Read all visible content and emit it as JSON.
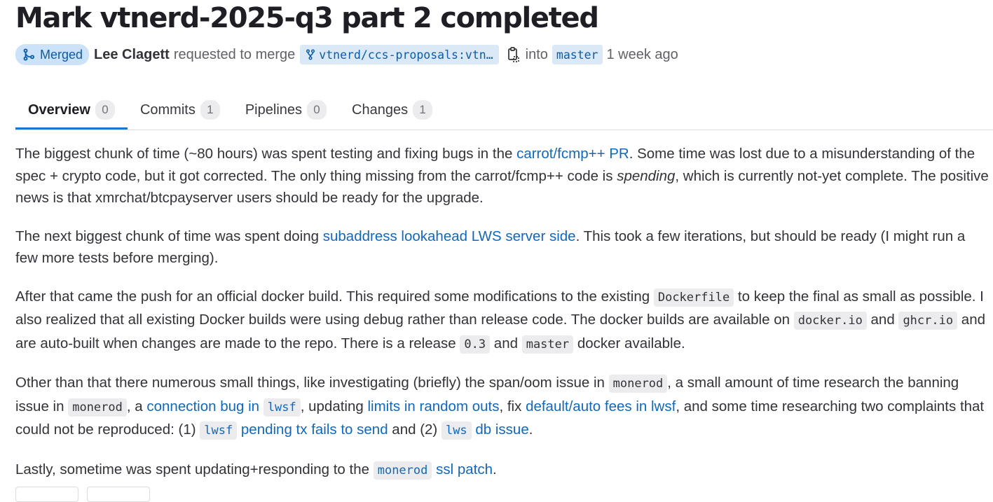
{
  "title": "Mark vtnerd-2025-q3 part 2 completed",
  "meta": {
    "status": "Merged",
    "author": "Lee Clagett",
    "action": "requested to merge",
    "source_branch": "vtnerd/ccs-proposals:vtn…",
    "into": "into",
    "target_branch": "master",
    "time": "1 week ago"
  },
  "tabs": [
    {
      "label": "Overview",
      "count": "0"
    },
    {
      "label": "Commits",
      "count": "1"
    },
    {
      "label": "Pipelines",
      "count": "0"
    },
    {
      "label": "Changes",
      "count": "1"
    }
  ],
  "p1": {
    "t1": "The biggest chunk of time (~80 hours) was spent testing and fixing bugs in the ",
    "link": "carrot/fcmp++ PR",
    "t2": ". Some time was lost due to a misunderstanding of the spec + crypto code, but it got corrected. The only thing missing from the carrot/fcmp++ code is ",
    "em": "spending",
    "t3": ", which is currently not-yet complete. The positive news is that xmrchat/btcpayserver users should be ready for the upgrade."
  },
  "p2": {
    "t1": "The next biggest chunk of time was spent doing ",
    "link": "subaddress lookahead LWS server side",
    "t2": ". This took a few iterations, but should be ready (I might run a few more tests before merging)."
  },
  "p3": {
    "t1": "After that came the push for an official docker build. This required some modifications to the existing ",
    "c1": "Dockerfile",
    "t2": " to keep the final as small as possible. I also realized that all existing Docker builds were using debug rather than release code. The docker builds are available on ",
    "c2": "docker.io",
    "t3": " and ",
    "c3": "ghcr.io",
    "t4": " and are auto-built when changes are made to the repo. There is a release ",
    "c4": "0.3",
    "t5": " and ",
    "c5": "master",
    "t6": " docker available."
  },
  "p4": {
    "t1": "Other than that there numerous small things, like investigating (briefly) the span/oom issue in ",
    "c1": "monerod",
    "t2": ", a small amount of time research the banning issue in ",
    "c2": "monerod",
    "t3": ", a ",
    "l1a": "connection bug in ",
    "l1c": "lwsf",
    "t4": ", updating ",
    "l2": "limits in random outs",
    "t5": ", fix ",
    "l3": "default/auto fees in lwsf",
    "t6": ", and some time researching two complaints that could not be reproduced: (1) ",
    "l4c": "lwsf",
    "l4b": " pending tx fails to send",
    "t7": " and (2) ",
    "l5c": "lws",
    "l5b": " db issue",
    "t8": "."
  },
  "p5": {
    "t1": "Lastly, sometime was spent updating+responding to the ",
    "lc": "monerod",
    "lb": " ssl patch",
    "t2": "."
  },
  "colors": {
    "accent": "#1f75cb",
    "link": "#1068bf",
    "merged_bg": "#cbe2f9",
    "merged_text": "#0b5cad"
  },
  "icons": {
    "merged": "merge-icon",
    "branch": "branch-icon",
    "copy": "copy-icon"
  }
}
